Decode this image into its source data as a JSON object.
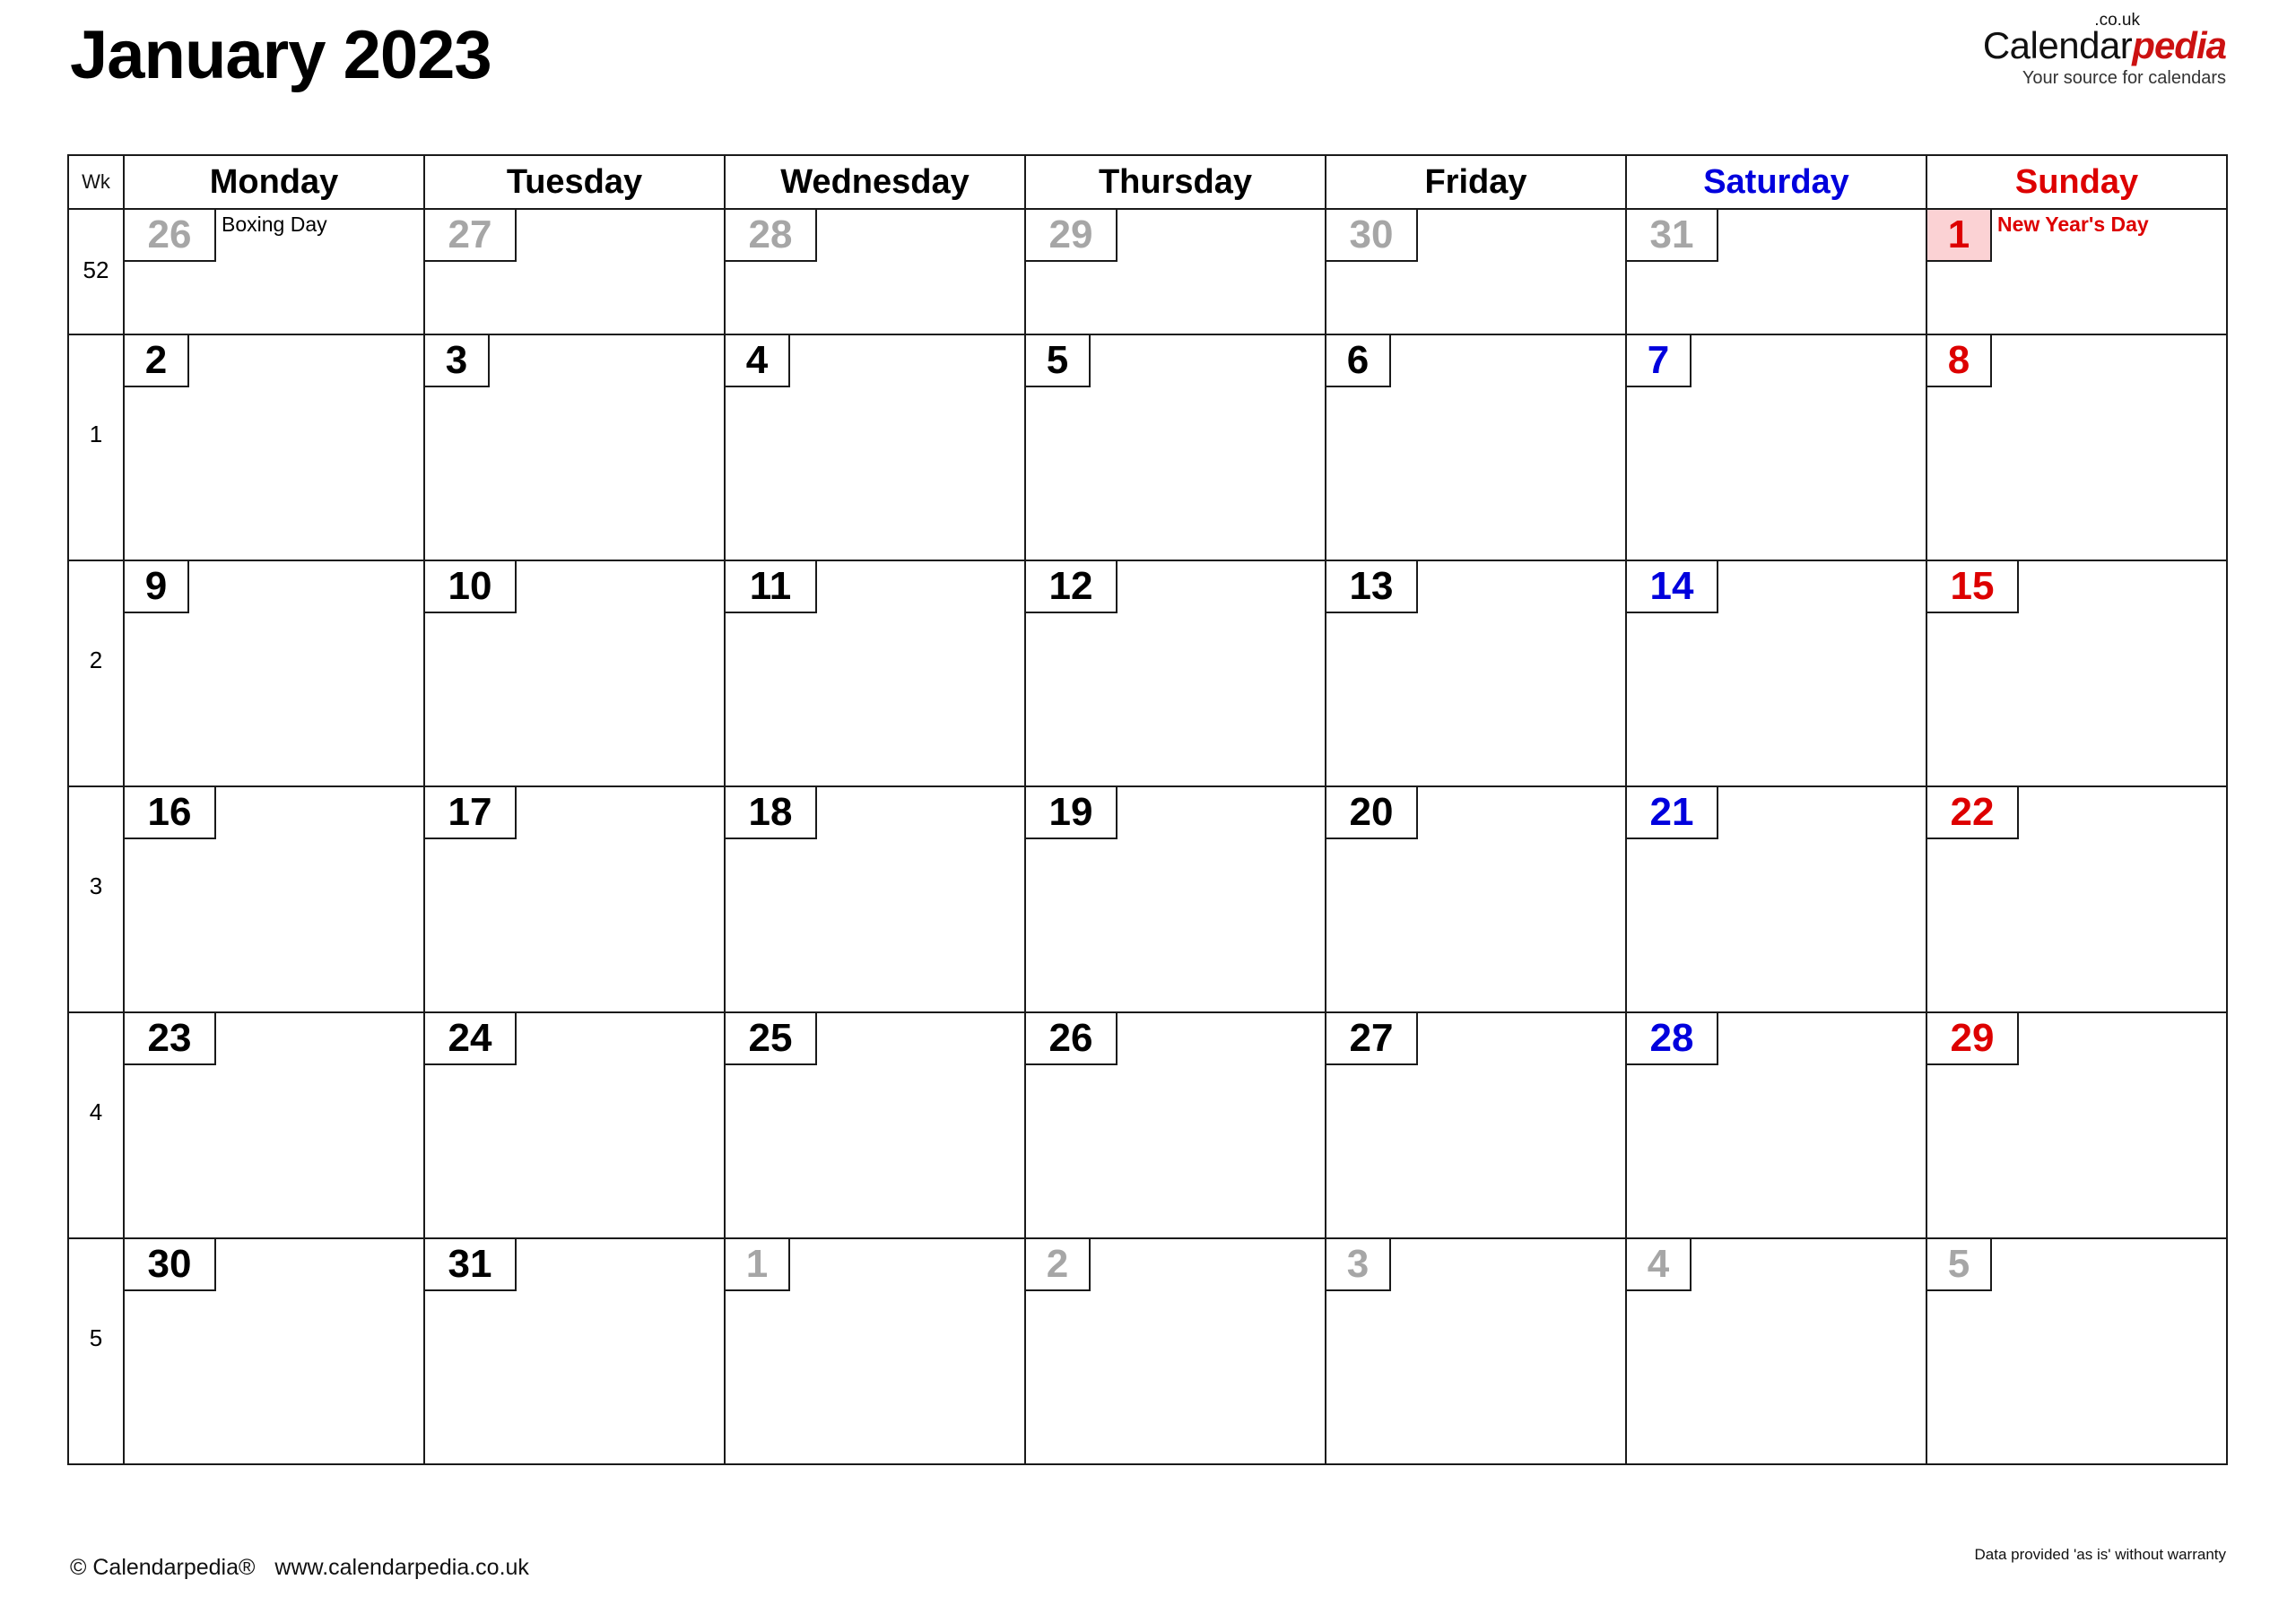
{
  "header": {
    "title": "January 2023",
    "brand": {
      "name_part1": "Calendar",
      "name_part2": "pedia",
      "tld": ".co.uk",
      "tagline": "Your source for calendars"
    }
  },
  "table": {
    "week_column_header": "Wk",
    "day_headers": [
      {
        "label": "Monday",
        "color": "#000000"
      },
      {
        "label": "Tuesday",
        "color": "#000000"
      },
      {
        "label": "Wednesday",
        "color": "#000000"
      },
      {
        "label": "Thursday",
        "color": "#000000"
      },
      {
        "label": "Friday",
        "color": "#000000"
      },
      {
        "label": "Saturday",
        "color": "#0000dd"
      },
      {
        "label": "Sunday",
        "color": "#dd0000"
      }
    ],
    "weeks": [
      {
        "week_number": "52",
        "days": [
          {
            "date": "26",
            "kind": "out",
            "event": "Boxing Day"
          },
          {
            "date": "27",
            "kind": "out",
            "event": ""
          },
          {
            "date": "28",
            "kind": "out",
            "event": ""
          },
          {
            "date": "29",
            "kind": "out",
            "event": ""
          },
          {
            "date": "30",
            "kind": "out",
            "event": ""
          },
          {
            "date": "31",
            "kind": "out",
            "event": ""
          },
          {
            "date": "1",
            "kind": "holiday",
            "event": "New Year's Day"
          }
        ]
      },
      {
        "week_number": "1",
        "days": [
          {
            "date": "2",
            "kind": "normal",
            "event": ""
          },
          {
            "date": "3",
            "kind": "normal",
            "event": ""
          },
          {
            "date": "4",
            "kind": "normal",
            "event": ""
          },
          {
            "date": "5",
            "kind": "normal",
            "event": ""
          },
          {
            "date": "6",
            "kind": "normal",
            "event": ""
          },
          {
            "date": "7",
            "kind": "sat",
            "event": ""
          },
          {
            "date": "8",
            "kind": "sun",
            "event": ""
          }
        ]
      },
      {
        "week_number": "2",
        "days": [
          {
            "date": "9",
            "kind": "normal",
            "event": ""
          },
          {
            "date": "10",
            "kind": "normal",
            "event": ""
          },
          {
            "date": "11",
            "kind": "normal",
            "event": ""
          },
          {
            "date": "12",
            "kind": "normal",
            "event": ""
          },
          {
            "date": "13",
            "kind": "normal",
            "event": ""
          },
          {
            "date": "14",
            "kind": "sat",
            "event": ""
          },
          {
            "date": "15",
            "kind": "sun",
            "event": ""
          }
        ]
      },
      {
        "week_number": "3",
        "days": [
          {
            "date": "16",
            "kind": "normal",
            "event": ""
          },
          {
            "date": "17",
            "kind": "normal",
            "event": ""
          },
          {
            "date": "18",
            "kind": "normal",
            "event": ""
          },
          {
            "date": "19",
            "kind": "normal",
            "event": ""
          },
          {
            "date": "20",
            "kind": "normal",
            "event": ""
          },
          {
            "date": "21",
            "kind": "sat",
            "event": ""
          },
          {
            "date": "22",
            "kind": "sun",
            "event": ""
          }
        ]
      },
      {
        "week_number": "4",
        "days": [
          {
            "date": "23",
            "kind": "normal",
            "event": ""
          },
          {
            "date": "24",
            "kind": "normal",
            "event": ""
          },
          {
            "date": "25",
            "kind": "normal",
            "event": ""
          },
          {
            "date": "26",
            "kind": "normal",
            "event": ""
          },
          {
            "date": "27",
            "kind": "normal",
            "event": ""
          },
          {
            "date": "28",
            "kind": "sat",
            "event": ""
          },
          {
            "date": "29",
            "kind": "sun",
            "event": ""
          }
        ]
      },
      {
        "week_number": "5",
        "days": [
          {
            "date": "30",
            "kind": "normal",
            "event": ""
          },
          {
            "date": "31",
            "kind": "normal",
            "event": ""
          },
          {
            "date": "1",
            "kind": "out",
            "event": ""
          },
          {
            "date": "2",
            "kind": "out",
            "event": ""
          },
          {
            "date": "3",
            "kind": "out",
            "event": ""
          },
          {
            "date": "4",
            "kind": "out",
            "event": ""
          },
          {
            "date": "5",
            "kind": "out",
            "event": ""
          }
        ]
      }
    ]
  },
  "footer": {
    "copyright": "© Calendarpedia®",
    "website": "www.calendarpedia.co.uk",
    "disclaimer": "Data provided 'as is' without warranty"
  },
  "colors": {
    "saturday": "#0000dd",
    "sunday": "#dd0000",
    "out_of_month": "#a6a6a6",
    "holiday_bg": "#fbd2d4",
    "grid": "#1a1a1a",
    "brand_red": "#cc1111"
  }
}
